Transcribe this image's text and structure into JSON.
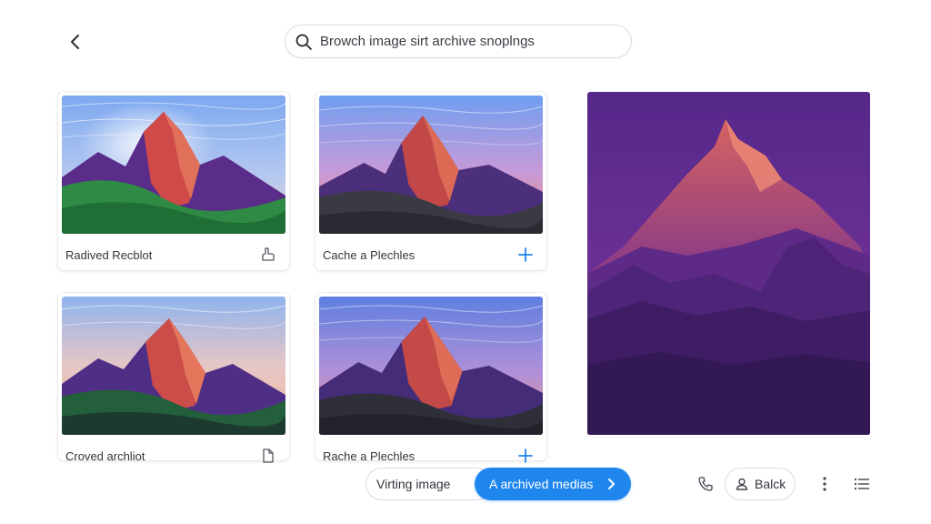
{
  "header": {
    "back_icon": "chevron-left-icon",
    "search": {
      "placeholder": "Browch image sirt archive snoplngs"
    }
  },
  "grid": {
    "cards": [
      {
        "title": "Radived Recblot",
        "action_icon": "share-icon"
      },
      {
        "title": "Cache a Plechles",
        "action_icon": "plus-icon"
      },
      {
        "title": "Croved archliot",
        "action_icon": "document-icon"
      },
      {
        "title": "Rache a Plechles",
        "action_icon": "plus-icon"
      }
    ]
  },
  "bottom_bar": {
    "secondary_label": "Virting image",
    "primary_label": "A archived medias",
    "profile_label": "Balck"
  },
  "colors": {
    "accent": "#1f86ee",
    "preview_bg": "#5a2a86",
    "text": "#2b2b33",
    "border": "#d9dbe1"
  }
}
